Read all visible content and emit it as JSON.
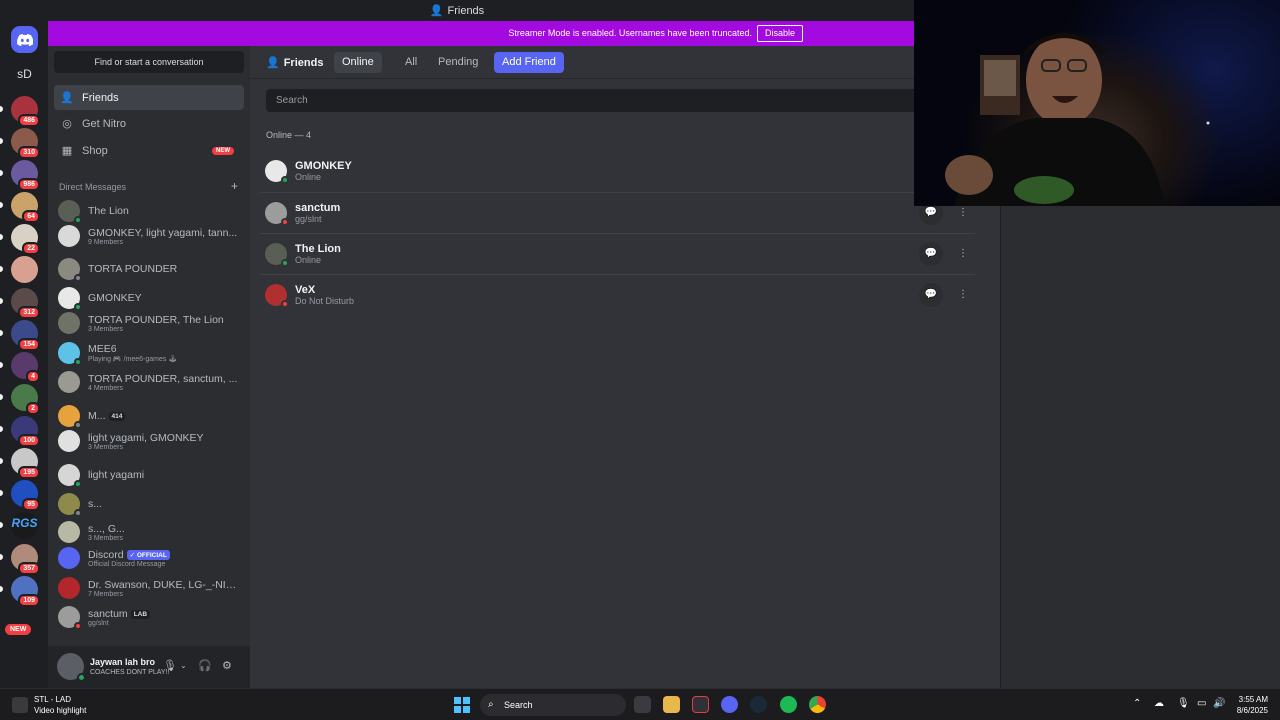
{
  "window": {
    "title": "Friends"
  },
  "banner": {
    "message": "Streamer Mode is enabled. Usernames have been truncated.",
    "disable_label": "Disable"
  },
  "rail": {
    "dm_home_label": "Discord home",
    "text_server": "sD",
    "badges": [
      "486",
      "310",
      "986",
      "64",
      "22",
      "",
      "312",
      "154",
      "4",
      "2",
      "100",
      "195",
      "95",
      "",
      "357",
      "109"
    ],
    "rgs_label": "RGS",
    "new_label": "NEW"
  },
  "sidebar": {
    "search_label": "Find or start a conversation",
    "nav": [
      {
        "label": "Friends",
        "icon": "friends-icon"
      },
      {
        "label": "Get Nitro",
        "icon": "nitro-icon"
      },
      {
        "label": "Shop",
        "icon": "shop-icon",
        "tag": "NEW"
      }
    ],
    "dm_header": "Direct Messages",
    "dms": [
      {
        "name": "The Lion",
        "sub": "",
        "status": "online",
        "color": "#5a5f55"
      },
      {
        "name": "GMONKEY, light yagami, tann...",
        "sub": "9 Members",
        "status": "",
        "color": "#d9d9d9"
      },
      {
        "name": "TORTA POUNDER",
        "sub": "",
        "status": "offline",
        "color": "#8a8a80"
      },
      {
        "name": "GMONKEY",
        "sub": "",
        "status": "online",
        "color": "#e8e8e8"
      },
      {
        "name": "TORTA POUNDER, The Lion",
        "sub": "3 Members",
        "status": "",
        "color": "#6f7266"
      },
      {
        "name": "MEE6",
        "sub": "Playing 🎮 /mee6-games 🕹",
        "status": "online",
        "color": "#5ec1e8"
      },
      {
        "name": "TORTA POUNDER, sanctum, ...",
        "sub": "4 Members",
        "status": "",
        "color": "#9a9a92"
      },
      {
        "name": "M...",
        "sub": "",
        "tag": "414",
        "status": "offline",
        "color": "#e6a23c"
      },
      {
        "name": "light yagami, GMONKEY",
        "sub": "3 Members",
        "status": "",
        "color": "#e0e0e0"
      },
      {
        "name": "light yagami",
        "sub": "",
        "status": "online",
        "color": "#d6d6d6"
      },
      {
        "name": "s...",
        "sub": "",
        "status": "offline",
        "color": "#8d8a4c"
      },
      {
        "name": "s..., G...",
        "sub": "3 Members",
        "status": "",
        "color": "#b7b9a5"
      },
      {
        "name": "Discord",
        "sub": "Official Discord Message",
        "tag": "✓ OFFICIAL",
        "status": "",
        "color": "#5865f2"
      },
      {
        "name": "Dr. Swanson, DUKE, LG-_-NIC...",
        "sub": "7 Members",
        "status": "",
        "color": "#b3262b"
      },
      {
        "name": "sanctum",
        "sub": "gg/slnt",
        "tag": "LAB",
        "status": "dnd",
        "color": "#9c9c9c"
      }
    ],
    "user": {
      "name": "Jaywan lah bro",
      "status": "COACHES DONT PLAY!!"
    }
  },
  "main": {
    "friends_label": "Friends",
    "tabs": [
      "Online",
      "All",
      "Pending"
    ],
    "add_friend_label": "Add Friend",
    "search_placeholder": "Search",
    "online_header": "Online — 4",
    "friends": [
      {
        "name": "GMONKEY",
        "status": "Online",
        "state": "online",
        "color": "#e8e8e8",
        "actions": false
      },
      {
        "name": "sanctum",
        "status": "gg/slnt",
        "state": "dnd",
        "color": "#9c9c9c",
        "actions": true
      },
      {
        "name": "The Lion",
        "status": "Online",
        "state": "online",
        "color": "#5a5f55",
        "actions": true
      },
      {
        "name": "VeX",
        "status": "Do Not Disturb",
        "state": "dnd",
        "color": "#b03030",
        "actions": true
      }
    ]
  },
  "taskbar": {
    "weather_title": "STL - LAD",
    "weather_sub": "Video highlight",
    "search_label": "Search",
    "time": "3:55 AM",
    "date": "8/6/2025"
  },
  "colors": {
    "accent": "#5865f2",
    "banner": "#a30ae0",
    "online": "#23a55a",
    "dnd": "#f23f43",
    "offline": "#80848e"
  }
}
